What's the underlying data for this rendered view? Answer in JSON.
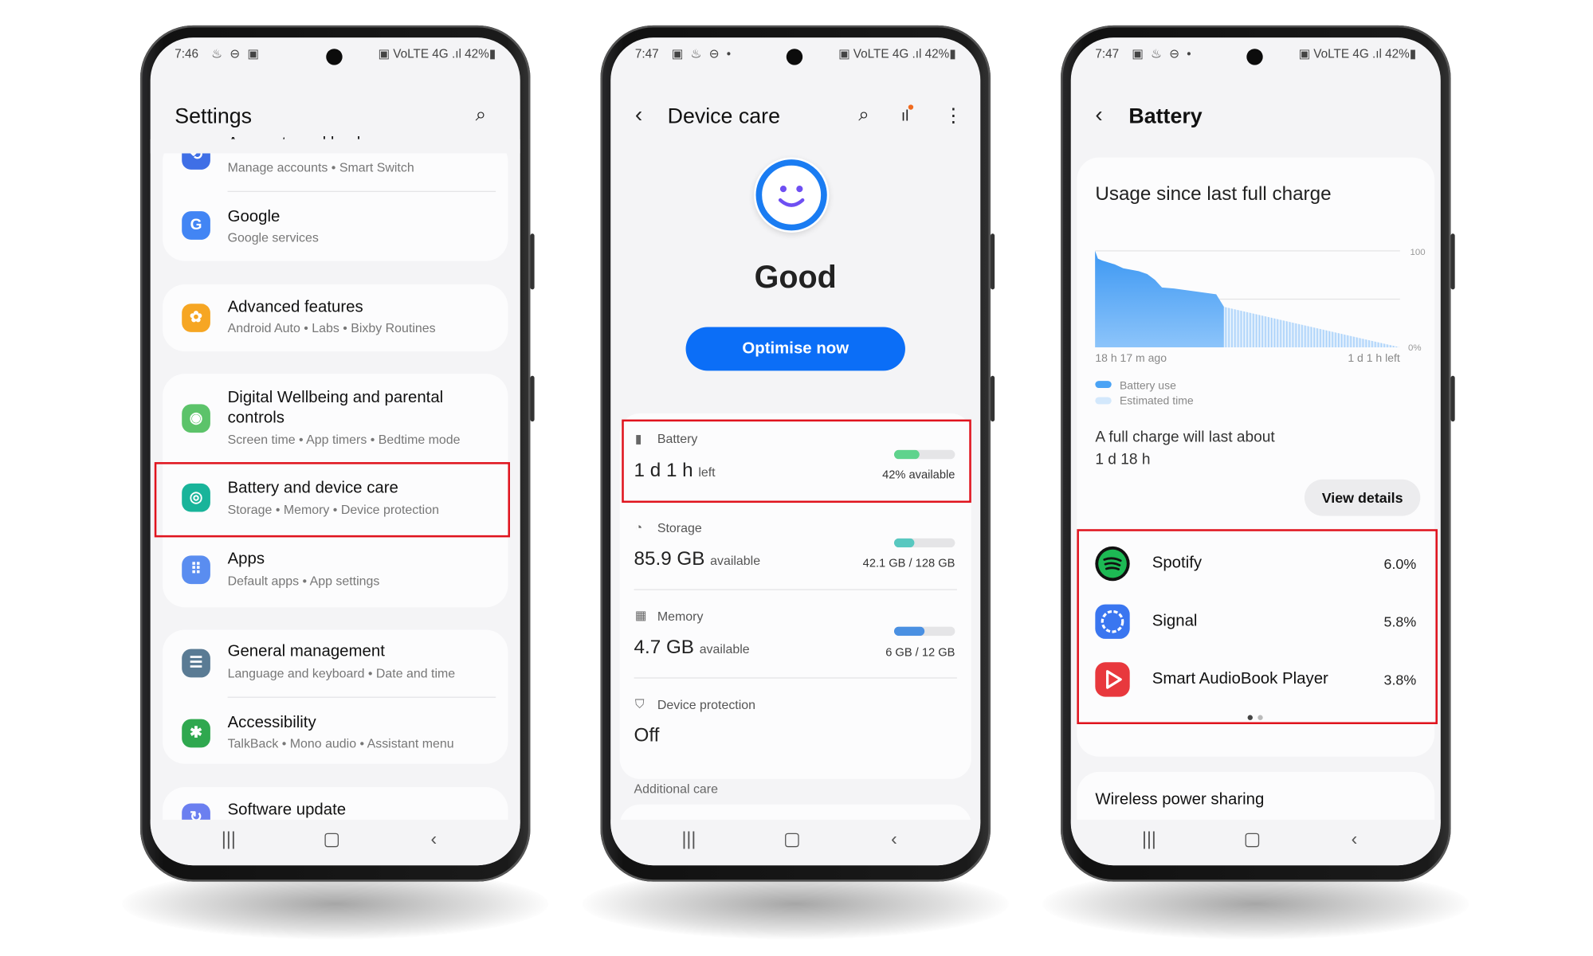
{
  "colors": {
    "accent": "#0b6ef7",
    "highlight": "#e0141e",
    "battery_bar": "#5fd38d",
    "storage_bar": "#58c8c0",
    "memory_bar": "#4a90e2",
    "chart_fill": "#4aa3f5",
    "chart_est": "#bcdcfb"
  },
  "phone1": {
    "status": {
      "time": "7:46",
      "left_icons": "♨ ⊖ ▣",
      "right": "▣ VoLTE 4G .ıl 42%▮"
    },
    "title": "Settings",
    "search_icon": "search-icon",
    "items": [
      {
        "title": "Accounts and backup",
        "subtitle": "Manage accounts  •  Smart Switch",
        "icon": "sync-icon",
        "color": "#3f6fe6"
      },
      {
        "title": "Google",
        "subtitle": "Google services",
        "icon": "google-icon",
        "color": "#4285f4"
      },
      {
        "title": "Advanced features",
        "subtitle": "Android Auto  •  Labs  •  Bixby Routines",
        "icon": "gear-plus-icon",
        "color": "#f6a623"
      },
      {
        "title": "Digital Wellbeing and parental controls",
        "subtitle": "Screen time  •  App timers  •  Bedtime mode",
        "icon": "wellbeing-icon",
        "color": "#5cc36a"
      },
      {
        "title": "Battery and device care",
        "subtitle": "Storage  •  Memory  •  Device protection",
        "icon": "device-care-icon",
        "color": "#19b49a"
      },
      {
        "title": "Apps",
        "subtitle": "Default apps  •  App settings",
        "icon": "apps-icon",
        "color": "#5a8df0"
      },
      {
        "title": "General management",
        "subtitle": "Language and keyboard  •  Date and time",
        "icon": "sliders-icon",
        "color": "#5a7b94"
      },
      {
        "title": "Accessibility",
        "subtitle": "TalkBack  •  Mono audio  •  Assistant menu",
        "icon": "accessibility-icon",
        "color": "#2fa84f"
      },
      {
        "title": "Software update",
        "subtitle": "",
        "icon": "update-icon",
        "color": "#6b7ff0"
      }
    ]
  },
  "phone2": {
    "status": {
      "time": "7:47",
      "left_icons": "▣ ♨ ⊖ •",
      "right": "▣ VoLTE 4G .ıl 42%▮"
    },
    "title": "Device care",
    "status_word": "Good",
    "optimise_label": "Optimise now",
    "battery": {
      "label": "Battery",
      "value": "1 d 1 h",
      "unit": "left",
      "detail": "42% available",
      "level": 42
    },
    "storage": {
      "label": "Storage",
      "value": "85.9 GB",
      "unit": "available",
      "detail": "42.1 GB / 128 GB",
      "level": 33
    },
    "memory": {
      "label": "Memory",
      "value": "4.7 GB",
      "unit": "available",
      "detail": "6 GB / 12 GB",
      "level": 50
    },
    "protection": {
      "label": "Device protection",
      "value": "Off"
    },
    "additional": "Additional care"
  },
  "phone3": {
    "status": {
      "time": "7:47",
      "left_icons": "▣ ♨ ⊖ •",
      "right": "▣ VoLTE 4G .ıl 42%▮"
    },
    "title": "Battery",
    "usage_title": "Usage since last full charge",
    "full_charge_label": "A full charge will last about",
    "full_charge_value": "1 d 18 h",
    "view_details": "View details",
    "apps": [
      {
        "name": "Spotify",
        "percent": "6.0%",
        "color": "#1db954",
        "icon": "spotify-icon"
      },
      {
        "name": "Signal",
        "percent": "5.8%",
        "color": "#3a76f0",
        "icon": "signal-icon"
      },
      {
        "name": "Smart AudioBook Player",
        "percent": "3.8%",
        "color": "#e8383d",
        "icon": "audiobook-icon"
      }
    ],
    "page_dots": {
      "count": 2,
      "active": 0
    },
    "wireless": "Wireless power sharing"
  },
  "chart_data": {
    "type": "area",
    "title": "Usage since last full charge",
    "x_unit": "hours relative to now",
    "x_range": [
      -18.28,
      25
    ],
    "x_tick_labels": [
      "18 h 17 m ago",
      "1 d 1 h left"
    ],
    "y_range": [
      0,
      100
    ],
    "y_tick_labels": [
      "100",
      "0%"
    ],
    "grid": true,
    "legend": "bottom-left",
    "series": [
      {
        "name": "Battery use",
        "x": [
          -18.3,
          -17.9,
          -17.3,
          -15.5,
          -14.3,
          -12.1,
          -10.9,
          -9.8,
          -8.8,
          -7.1,
          -1.1,
          0
        ],
        "y": [
          100,
          92,
          90,
          86,
          82,
          79,
          76,
          70,
          62,
          61,
          55,
          42
        ]
      },
      {
        "name": "Estimated time",
        "x": [
          0,
          25
        ],
        "y": [
          42,
          0
        ]
      }
    ]
  }
}
